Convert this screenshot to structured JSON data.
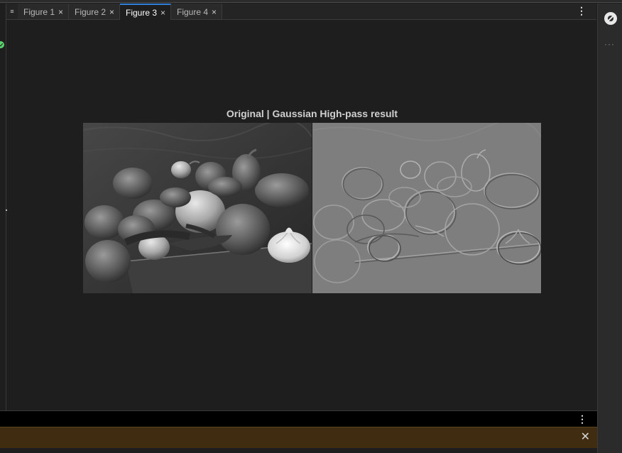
{
  "tabs": [
    {
      "label": "Figure 1",
      "active": false
    },
    {
      "label": "Figure 2",
      "active": false
    },
    {
      "label": "Figure 3",
      "active": true
    },
    {
      "label": "Figure 4",
      "active": false
    }
  ],
  "icons": {
    "tab_overflow": "≡",
    "tab_close": "×",
    "more_vertical": "⋮",
    "more_horizontal": "···",
    "banner_close": "✕",
    "pin": "pin-icon"
  },
  "figure": {
    "title": "Original | Gaussian High-pass result",
    "left_image": "original-peppers-image",
    "right_image": "gaussian-highpass-peppers-image"
  },
  "colors": {
    "accent": "#2f7fd6",
    "status_ok": "#5bd16d",
    "banner_bg": "#3f2c11",
    "background": "#1e1e1e"
  }
}
